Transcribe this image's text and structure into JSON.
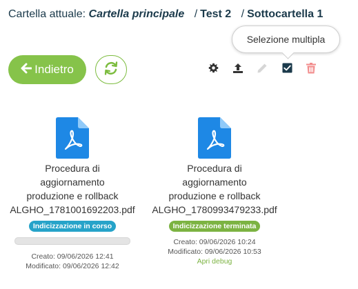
{
  "breadcrumb": {
    "prefix": "Cartella attuale:",
    "current": "Cartella principale",
    "items": [
      "Test 2",
      "Sottocartella 1"
    ],
    "separator": "/"
  },
  "tooltip": {
    "text": "Selezione multipla"
  },
  "toolbar": {
    "back_label": "Indietro",
    "back_icon": "arrow-left-icon",
    "refresh_icon": "refresh-icon",
    "settings_icon": "gear-icon",
    "upload_icon": "upload-icon",
    "edit_icon": "pencil-icon",
    "select_icon": "checkbox-checked-icon",
    "delete_icon": "trash-icon"
  },
  "colors": {
    "accent_green": "#86c34a",
    "file_blue": "#1e88e5",
    "badge_indexing": "#26a3c9",
    "badge_done": "#7cb342",
    "delete_red": "#f28b8b"
  },
  "files": [
    {
      "name_lines": [
        "Procedura di",
        "aggiornamento",
        "produzione e rollback",
        "ALGHO_1781001692203.pdf"
      ],
      "status": "Indicizzazione in corso",
      "status_kind": "indexing",
      "progress_percent": 0,
      "created": "Creato: 09/06/2026 12:41",
      "modified": "Modificato: 09/06/2026 12:42"
    },
    {
      "name_lines": [
        "Procedura di",
        "aggiornamento",
        "produzione e rollback",
        "ALGHO_1780993479233.pdf"
      ],
      "status": "Indicizzazione terminata",
      "status_kind": "done",
      "created": "Creato: 09/06/2026 10:24",
      "modified": "Modificato: 09/06/2026 10:53",
      "debug_link": "Apri debug"
    }
  ]
}
